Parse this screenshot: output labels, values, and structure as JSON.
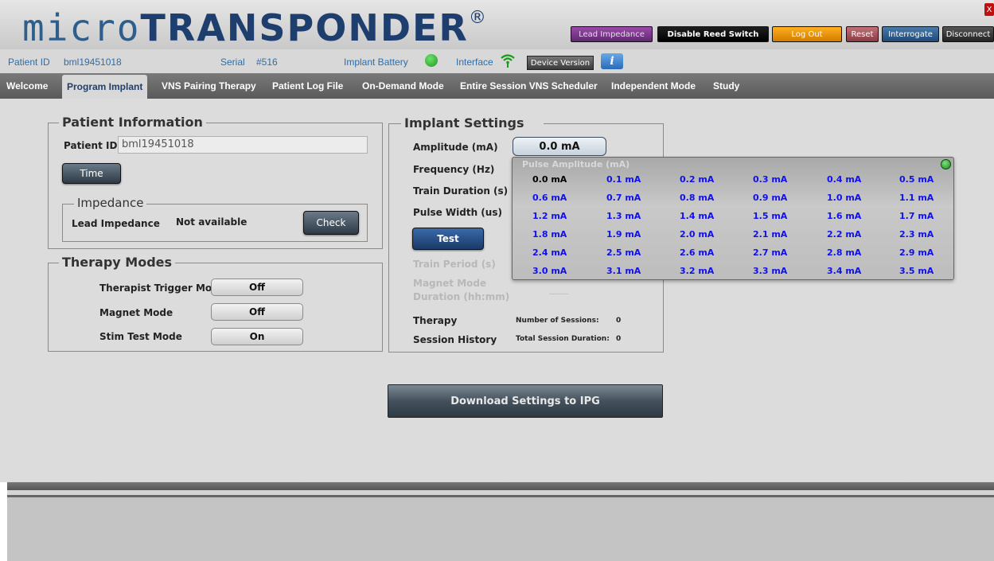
{
  "header": {
    "logo_micro": "micro",
    "logo_transponder": "TRANSPONDER",
    "logo_reg": "®",
    "buttons": {
      "lead_impedance": "Lead Impedance",
      "disable_reed": "Disable Reed Switch",
      "log_out": "Log Out",
      "reset": "Reset",
      "interrogate": "Interrogate",
      "disconnect": "Disconnect",
      "close": "X"
    }
  },
  "infobar": {
    "patient_id_label": "Patient ID",
    "patient_id_value": "bml19451018",
    "serial_label": "Serial",
    "serial_value": "#516",
    "battery_label": "Implant Battery",
    "interface_label": "Interface",
    "device_version": "Device Version",
    "info": "i"
  },
  "tabs": [
    {
      "label": "Welcome"
    },
    {
      "label": "Program Implant"
    },
    {
      "label": "VNS Pairing Therapy"
    },
    {
      "label": "Patient Log File"
    },
    {
      "label": "On-Demand Mode"
    },
    {
      "label": "Entire Session VNS Scheduler"
    },
    {
      "label": "Independent Mode"
    },
    {
      "label": "Study"
    }
  ],
  "patient_info": {
    "legend": "Patient Information",
    "id_label": "Patient ID:",
    "id_value": "bml19451018",
    "time_button": "Time",
    "impedance_legend": "Impedance",
    "lead_impedance_label": "Lead Impedance",
    "lead_impedance_value": "Not available",
    "check_button": "Check"
  },
  "therapy_modes": {
    "legend": "Therapy Modes",
    "rows": [
      {
        "label": "Therapist Trigger Mode",
        "value": "Off"
      },
      {
        "label": "Magnet Mode",
        "value": "Off"
      },
      {
        "label": "Stim Test Mode",
        "value": "On"
      }
    ]
  },
  "implant_settings": {
    "legend": "Implant Settings",
    "amplitude_label": "Amplitude (mA)",
    "amplitude_value": "0.0 mA",
    "frequency_label": "Frequency (Hz)",
    "train_duration_label": "Train Duration (s)",
    "pulse_width_label": "Pulse Width (us)",
    "test_button": "Test",
    "train_period_label": "Train Period (s)",
    "magnet_mode_label_1": "Magnet Mode",
    "magnet_mode_label_2": "Duration (hh:mm)",
    "magnet_mode_value": "____",
    "therapy_label": "Therapy",
    "session_history_label": "Session History",
    "num_sessions_label": "Number of Sessions:",
    "num_sessions_value": "0",
    "total_duration_label": "Total Session Duration:",
    "total_duration_value": "0"
  },
  "amp_popup": {
    "title": "Pulse Amplitude  (mA)",
    "selected": "0.0 mA",
    "options": [
      "0.0 mA",
      "0.1 mA",
      "0.2 mA",
      "0.3 mA",
      "0.4 mA",
      "0.5 mA",
      "0.6 mA",
      "0.7 mA",
      "0.8 mA",
      "0.9 mA",
      "1.0 mA",
      "1.1 mA",
      "1.2 mA",
      "1.3 mA",
      "1.4 mA",
      "1.5 mA",
      "1.6 mA",
      "1.7 mA",
      "1.8 mA",
      "1.9 mA",
      "2.0 mA",
      "2.1 mA",
      "2.2 mA",
      "2.3 mA",
      "2.4 mA",
      "2.5 mA",
      "2.6 mA",
      "2.7 mA",
      "2.8 mA",
      "2.9 mA",
      "3.0 mA",
      "3.1 mA",
      "3.2 mA",
      "3.3 mA",
      "3.4 mA",
      "3.5 mA"
    ]
  },
  "download_button": "Download Settings to IPG",
  "colors": {
    "brand_blue": "#1e3f6e",
    "option_blue": "#1010ee",
    "battery_green": "#1a9a1a"
  }
}
